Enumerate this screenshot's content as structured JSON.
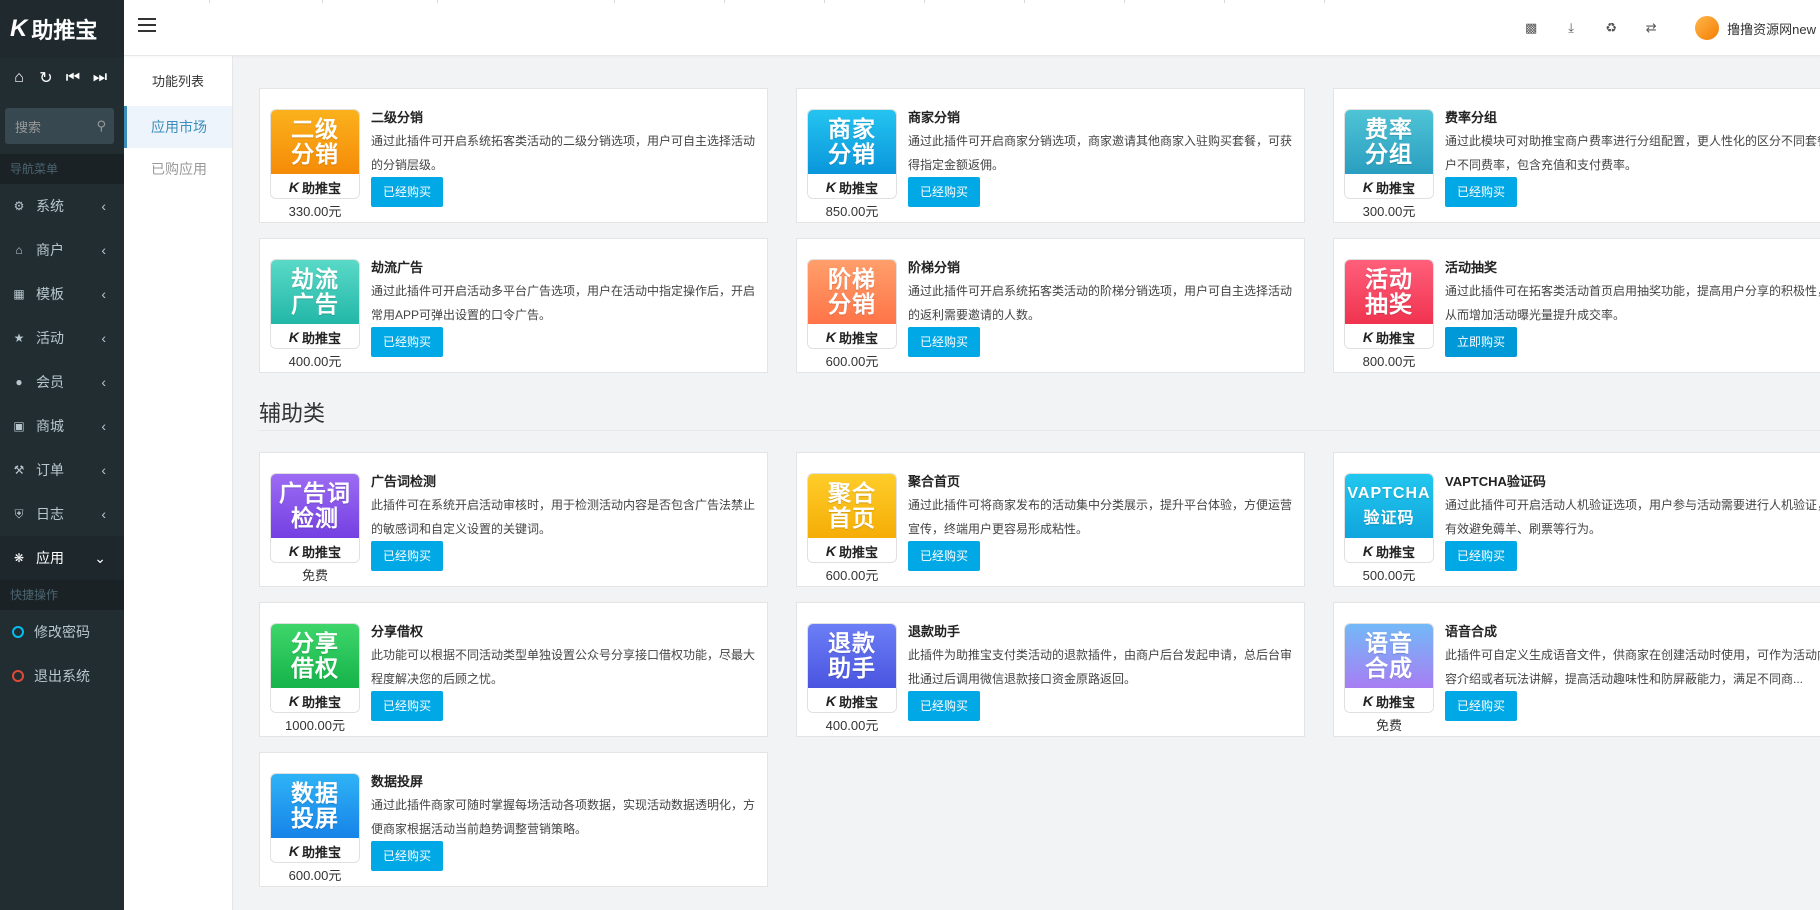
{
  "brand": {
    "logo_mark": "K",
    "name": "助推宝"
  },
  "sidebar": {
    "search_placeholder": "搜索",
    "nav_header": "导航菜单",
    "items": [
      {
        "label": "系统",
        "icon": "gear-icon"
      },
      {
        "label": "商户",
        "icon": "home-icon"
      },
      {
        "label": "模板",
        "icon": "sitemap-icon"
      },
      {
        "label": "活动",
        "icon": "trophy-icon"
      },
      {
        "label": "会员",
        "icon": "users-icon"
      },
      {
        "label": "商城",
        "icon": "cart-icon"
      },
      {
        "label": "订单",
        "icon": "gavel-icon"
      },
      {
        "label": "日志",
        "icon": "shield-icon"
      },
      {
        "label": "应用",
        "icon": "apps-icon"
      }
    ],
    "quick_header": "快捷操作",
    "quick_items": [
      {
        "label": "修改密码",
        "color": "#00c0ef"
      },
      {
        "label": "退出系统",
        "color": "#dd4b39"
      }
    ]
  },
  "subnav": {
    "title": "功能列表",
    "items": [
      {
        "label": "应用市场"
      },
      {
        "label": "已购应用"
      }
    ]
  },
  "topbar": {
    "user_name": "撸撸资源网new"
  },
  "sections": [
    {
      "title": "辅助类"
    }
  ],
  "brand_tile_label": "助推宝",
  "cards": [
    {
      "tile_text": "二级\n分销",
      "tile_color": "orange",
      "title": "二级分销",
      "desc": "通过此插件可开启系统拓客类活动的二级分销选项，用户可自主选择活动的分销层级。",
      "price": "330.00元",
      "button": "已经购买"
    },
    {
      "tile_text": "商家\n分销",
      "tile_color": "blue",
      "title": "商家分销",
      "desc": "通过此插件可开启商家分销选项，商家邀请其他商家入驻购买套餐，可获得指定金额返佣。",
      "price": "850.00元",
      "button": "已经购买"
    },
    {
      "tile_text": "费率\n分组",
      "tile_color": "teal",
      "title": "费率分组",
      "desc": "通过此模块可对助推宝商户费率进行分组配置，更人性化的区分不同套餐户不同费率，包含充值和支付费率。",
      "price": "300.00元",
      "button": "已经购买"
    },
    {
      "tile_text": "劫流\n广告",
      "tile_color": "green-teal",
      "title": "劫流广告",
      "desc": "通过此插件可开启活动多平台广告选项，用户在活动中指定操作后，开启常用APP可弹出设置的口令广告。",
      "price": "400.00元",
      "button": "已经购买"
    },
    {
      "tile_text": "阶梯\n分销",
      "tile_color": "salmon",
      "title": "阶梯分销",
      "desc": "通过此插件可开启系统拓客类活动的阶梯分销选项，用户可自主选择活动的返利需要邀请的人数。",
      "price": "600.00元",
      "button": "已经购买"
    },
    {
      "tile_text": "活动\n抽奖",
      "tile_color": "red",
      "title": "活动抽奖",
      "desc": "通过此插件可在拓客类活动首页启用抽奖功能，提高用户分享的积极性，从而增加活动曝光量提升成交率。",
      "price": "800.00元",
      "button": "立即购买"
    },
    {
      "tile_text": "广告词\n检测",
      "tile_color": "purple",
      "title": "广告词检测",
      "desc": "此插件可在系统开启活动审核时，用于检测活动内容是否包含广告法禁止的敏感词和自定义设置的关键词。",
      "price": "免费",
      "button": "已经购买"
    },
    {
      "tile_text": "聚合\n首页",
      "tile_color": "yellow",
      "title": "聚合首页",
      "desc": "通过此插件可将商家发布的活动集中分类展示，提升平台体验，方便运营宣传，终端用户更容易形成粘性。",
      "price": "600.00元",
      "button": "已经购买"
    },
    {
      "tile_text": "VAPTCHA\n验证码",
      "tile_color": "cyan",
      "title": "VAPTCHA验证码",
      "desc": "通过此插件可开启活动人机验证选项，用户参与活动需要进行人机验证，有效避免薅羊、刷票等行为。",
      "price": "500.00元",
      "button": "已经购买"
    },
    {
      "tile_text": "分享\n借权",
      "tile_color": "green",
      "title": "分享借权",
      "desc": "此功能可以根据不同活动类型单独设置公众号分享接口借权功能，尽最大程度解决您的后顾之忧。",
      "price": "1000.00元",
      "button": "已经购买"
    },
    {
      "tile_text": "退款\n助手",
      "tile_color": "indigo",
      "title": "退款助手",
      "desc": "此插件为助推宝支付类活动的退款插件，由商户后台发起申请，总后台审批通过后调用微信退款接口资金原路返回。",
      "price": "400.00元",
      "button": "已经购买"
    },
    {
      "tile_text": "语音\n合成",
      "tile_color": "lilac",
      "title": "语音合成",
      "desc": "此插件可自定义生成语音文件，供商家在创建活动时使用，可作为活动内容介绍或者玩法讲解，提高活动趣味性和防屏蔽能力，满足不同商...",
      "price": "免费",
      "button": "已经购买"
    },
    {
      "tile_text": "数据\n投屏",
      "tile_color": "sky",
      "title": "数据投屏",
      "desc": "通过此插件商家可随时掌握每场活动各项数据，实现活动数据透明化，方便商家根据活动当前趋势调整营销策略。",
      "price": "600.00元",
      "button": "已经购买"
    }
  ]
}
